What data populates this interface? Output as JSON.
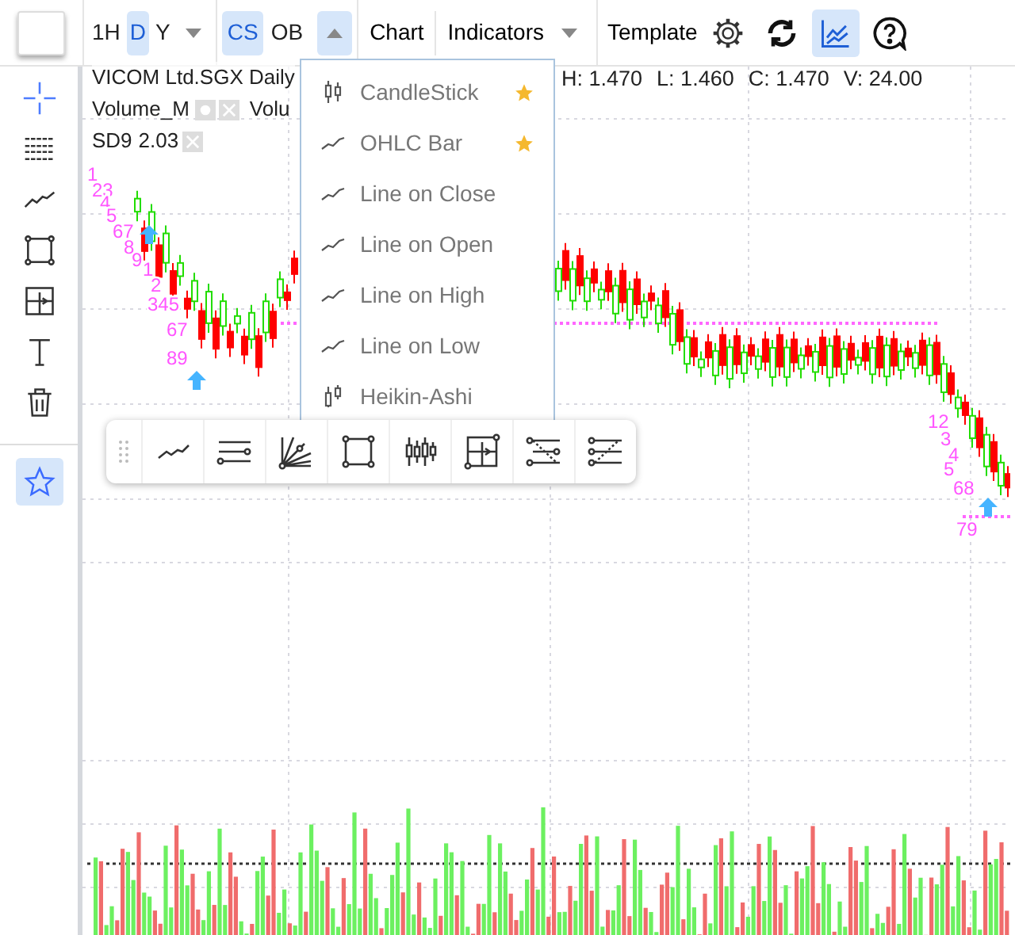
{
  "toolbar": {
    "intervals": [
      {
        "label": "1H",
        "selected": false
      },
      {
        "label": "D",
        "selected": true
      },
      {
        "label": "Y",
        "selected": false
      }
    ],
    "modes": [
      {
        "label": "CS",
        "selected": true
      },
      {
        "label": "OB",
        "selected": false
      }
    ],
    "chart_label": "Chart",
    "indicators_label": "Indicators",
    "template_label": "Template",
    "tools": [
      {
        "kind": "settings",
        "selected": false
      },
      {
        "kind": "refresh",
        "selected": false
      },
      {
        "kind": "chart",
        "selected": true
      },
      {
        "kind": "help",
        "selected": false
      }
    ]
  },
  "left_tools": [
    {
      "kind": "crosshair",
      "selected": true
    },
    {
      "kind": "lines",
      "selected": false
    },
    {
      "kind": "trend",
      "selected": false
    },
    {
      "kind": "rect",
      "selected": false
    },
    {
      "kind": "measure",
      "selected": false
    },
    {
      "kind": "text",
      "selected": false
    },
    {
      "kind": "trash",
      "selected": false
    }
  ],
  "favorites": {
    "selected": true
  },
  "legend": {
    "title": "VICOM Ltd.SGX Daily",
    "ohlc": [
      "H: 1.470",
      "L: 1.460",
      "C: 1.470",
      "V: 24.00"
    ],
    "rows": [
      [
        {
          "name": "Volume_M",
          "settings": true,
          "close": true
        },
        {
          "name": "Volu",
          "settings": false,
          "close": false
        }
      ],
      [
        {
          "name": "SD9",
          "value": "2.03",
          "settings": false,
          "close": true
        }
      ]
    ]
  },
  "chart_type_menu": {
    "expanded": true,
    "items": [
      {
        "kind": "candle",
        "label": "CandleStick",
        "starred": true
      },
      {
        "kind": "line",
        "label": "OHLC Bar",
        "starred": true
      },
      {
        "kind": "line",
        "label": "Line on Close",
        "starred": false
      },
      {
        "kind": "line",
        "label": "Line on Open",
        "starred": false
      },
      {
        "kind": "line",
        "label": "Line on High",
        "starred": false
      },
      {
        "kind": "line",
        "label": "Line on Low",
        "starred": false
      },
      {
        "kind": "heikin",
        "label": "Heikin-Ashi",
        "starred": false
      }
    ]
  },
  "drawing_toolbar": {
    "tools": [
      {
        "kind": "trend"
      },
      {
        "kind": "hlines"
      },
      {
        "kind": "fan"
      },
      {
        "kind": "rect"
      },
      {
        "kind": "candles"
      },
      {
        "kind": "measure"
      },
      {
        "kind": "fib"
      },
      {
        "kind": "fib2"
      }
    ]
  },
  "sequence_labels": [
    "1",
    "23",
    "4",
    "5",
    "67",
    "8",
    "9",
    "1",
    "2",
    "345",
    "67",
    "89",
    "12",
    "3",
    "4",
    "5",
    "68",
    "79"
  ]
}
